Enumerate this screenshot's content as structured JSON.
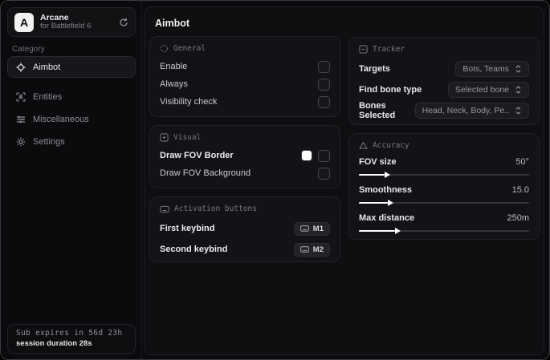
{
  "sidebar": {
    "app": {
      "initial": "A",
      "name": "Arcane",
      "subtitle": "for Battlefield 6"
    },
    "category_label": "Category",
    "items": [
      {
        "label": "Aimbot",
        "active": true
      },
      {
        "label": "Entities",
        "active": false
      },
      {
        "label": "Miscellaneous",
        "active": false
      },
      {
        "label": "Settings",
        "active": false
      }
    ],
    "status": {
      "expiry": "Sub expires in 56d 23h",
      "session": "session duration 28s"
    }
  },
  "main": {
    "title": "Aimbot",
    "general": {
      "title": "General",
      "rows": [
        {
          "label": "Enable",
          "checked": false
        },
        {
          "label": "Always",
          "checked": false
        },
        {
          "label": "Visibility check",
          "checked": false
        }
      ]
    },
    "visual": {
      "title": "Visual",
      "rows": [
        {
          "label": "Draw FOV Border",
          "swatch": "#ffffff",
          "checked": false
        },
        {
          "label": "Draw FOV Background",
          "checked": false
        }
      ]
    },
    "activation": {
      "title": "Activation buttons",
      "rows": [
        {
          "label": "First keybind",
          "key": "M1"
        },
        {
          "label": "Second keybind",
          "key": "M2"
        }
      ]
    },
    "tracker": {
      "title": "Tracker",
      "rows": [
        {
          "label": "Targets",
          "value": "Bots, Teams"
        },
        {
          "label": "Find bone type",
          "value": "Selected bone"
        },
        {
          "label": "Bones Selected",
          "value": "Head, Neck, Body, Pe.."
        }
      ]
    },
    "accuracy": {
      "title": "Accuracy",
      "rows": [
        {
          "label": "FOV size",
          "value": "50°",
          "percent": 15
        },
        {
          "label": "Smoothness",
          "value": "15.0",
          "percent": 17
        },
        {
          "label": "Max distance",
          "value": "250m",
          "percent": 21
        }
      ]
    }
  },
  "colors": {
    "accent": "#ffffff",
    "page_bg": "#0b0b0d",
    "card_bg": "#131317",
    "border": "#222228"
  }
}
